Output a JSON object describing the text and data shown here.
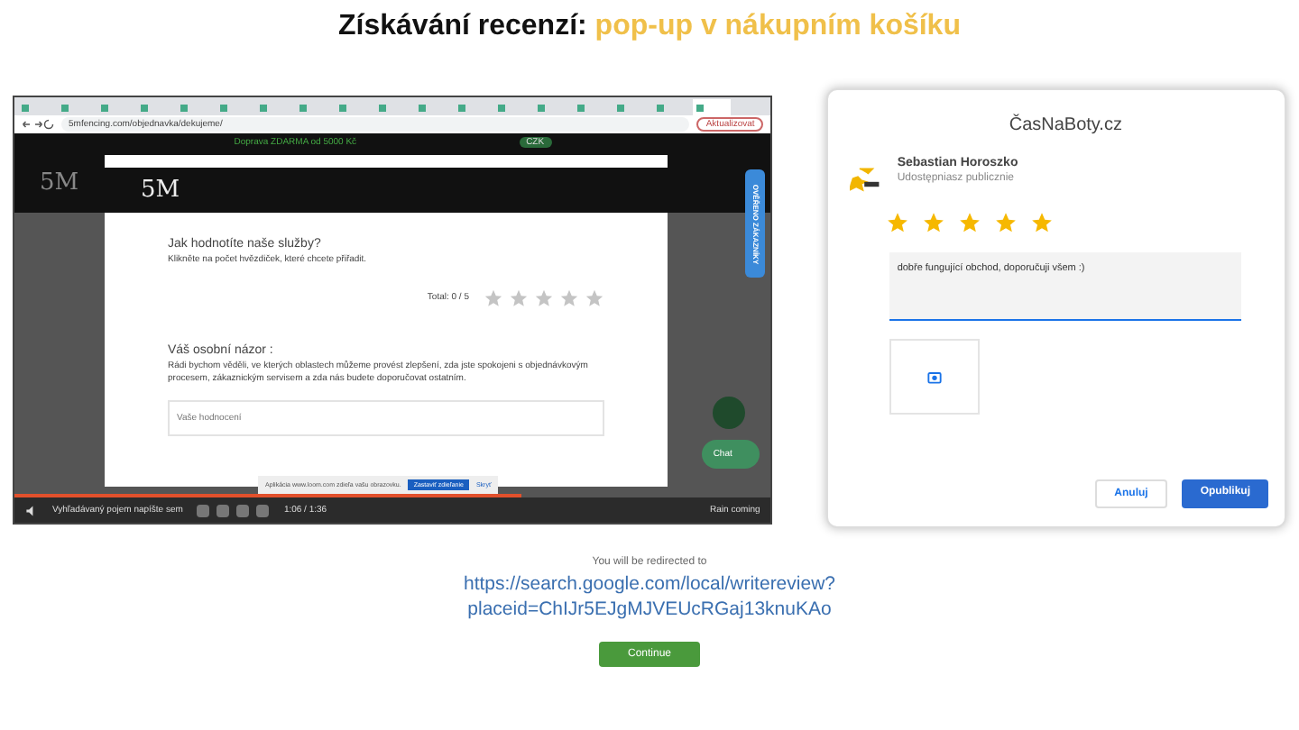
{
  "title": {
    "lead": "Získávání recenzí:",
    "highlight": "pop-up v nákupním košíku"
  },
  "browser": {
    "tabs": [
      {
        "selected": false
      },
      {
        "selected": false
      },
      {
        "selected": false
      },
      {
        "selected": false
      },
      {
        "selected": false
      },
      {
        "selected": false
      },
      {
        "selected": false
      },
      {
        "selected": false
      },
      {
        "selected": false
      },
      {
        "selected": false
      },
      {
        "selected": false
      },
      {
        "selected": false
      },
      {
        "selected": false
      },
      {
        "selected": false
      },
      {
        "selected": false
      },
      {
        "selected": false
      },
      {
        "selected": false
      },
      {
        "selected": true
      }
    ],
    "address": "5mfencing.com/objednavka/dekujeme/",
    "update_button": "Aktualizovat"
  },
  "shop": {
    "promo": "Doprava ZDARMA od 5000 Kč",
    "currency": "CZK",
    "logo": "5M",
    "side_tab": "OVĚŘENO ZÁKAZNÍKY",
    "chat": "Chat"
  },
  "rating_modal": {
    "logo": "5M",
    "question": "Jak hodnotíte naše služby?",
    "instruction": "Klikněte na počet hvězdiček, které chcete přiřadit.",
    "total": "Total: 0 / 5",
    "stars": 0,
    "opinion_heading": "Váš osobní názor :",
    "opinion_text": "Rádi bychom věděli, ve kterých oblastech můžeme provést zlepšení, zda jste spokojeni s objednávkovým procesem, zákaznickým servisem a zda nás budete doporučovat ostatním.",
    "placeholder": "Vaše hodnocení"
  },
  "sharing_bar": {
    "message": "Aplikácia www.loom.com zdieľa vašu obrazovku.",
    "stop_button": "Zastaviť zdieľanie",
    "hide_button": "Skryť"
  },
  "video": {
    "time": "1:06 / 1:36",
    "level": 0.67
  },
  "taskbar": {
    "search": "Vyhľadávaný pojem napíšte sem",
    "weather": "Rain coming"
  },
  "review_dialog": {
    "place": "ČasNaBoty.cz",
    "user": "Sebastian Horoszko",
    "visibility": "Udostępniasz publicznie",
    "stars": 5,
    "review": "dobře fungující obchod, doporučuji všem :)",
    "cancel": "Anuluj",
    "publish": "Opublikuj"
  },
  "redirect": {
    "note": "You will be redirected to",
    "url": "https://search.google.com/local/writereview?placeid=ChIJr5EJgMJVEUcRGaj13knuKAo",
    "continue": "Continue"
  }
}
